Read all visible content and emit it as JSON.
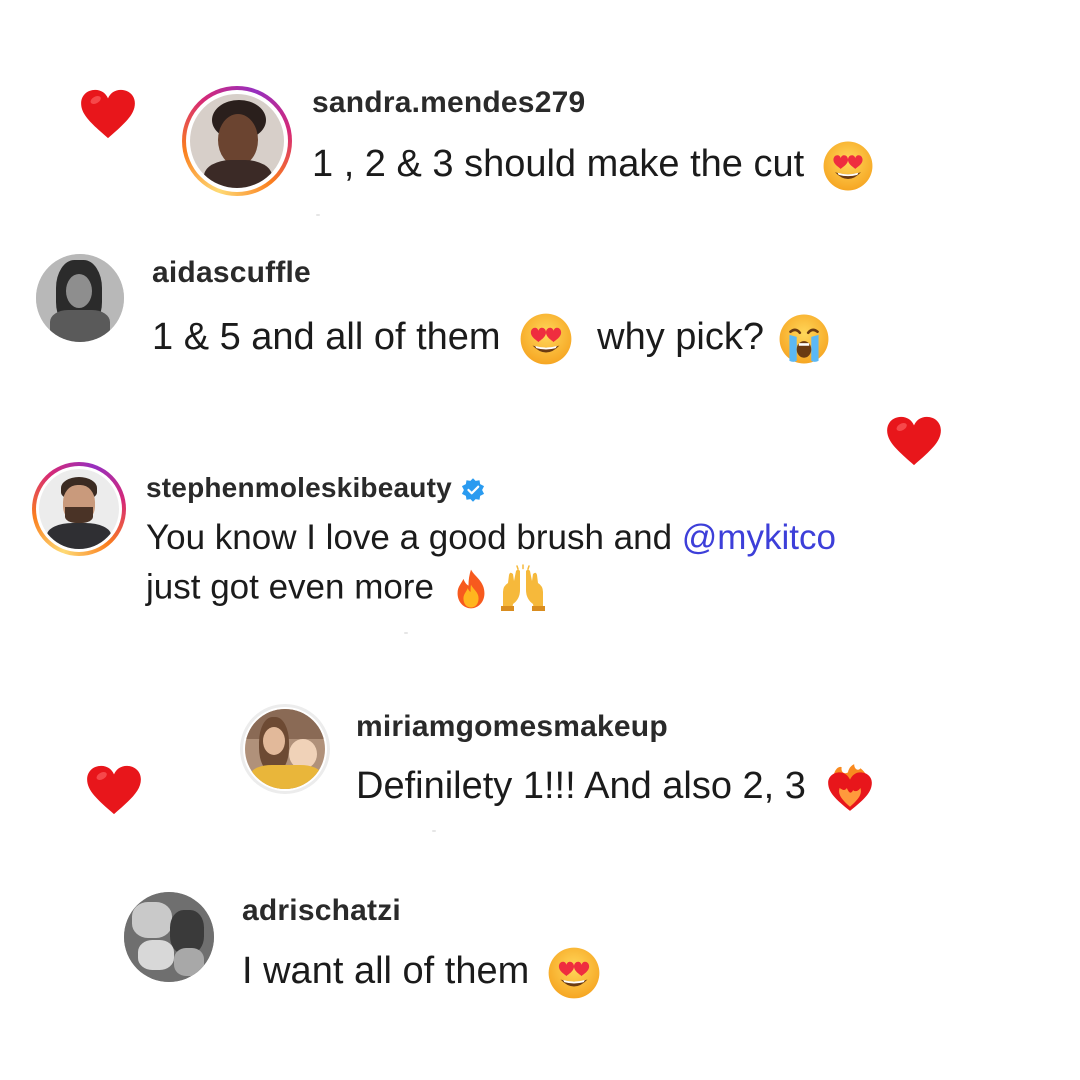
{
  "colors": {
    "heart": "#e8161b",
    "mention": "#3d3fd9",
    "verified": "#2a9bf0",
    "text": "#1b1b1b"
  },
  "comments": [
    {
      "username": "sandra.mendes279",
      "text": "1 , 2 & 3 should make the cut",
      "emojis": [
        "heart-eyes-emoji"
      ],
      "liked": true,
      "story_ring": true
    },
    {
      "username": "aidascuffle",
      "text_a": "1 &  5 and all of them",
      "text_b": "why pick?",
      "emojis": [
        "heart-eyes-emoji",
        "crying-emoji"
      ],
      "liked": false,
      "story_ring": false
    },
    {
      "username": "stephenmoleskibeauty",
      "verified": true,
      "text_line1": "You know I love a good brush and ",
      "mention": "@mykitco",
      "text_line2": "just got even more",
      "emojis": [
        "fire-emoji",
        "raising-hands-emoji"
      ],
      "liked": true,
      "story_ring": true
    },
    {
      "username": "miriamgomesmakeup",
      "text": "Definilety 1!!! And also 2, 3",
      "emojis": [
        "heart-on-fire-emoji"
      ],
      "liked": true,
      "story_ring": false
    },
    {
      "username": "adrischatzi",
      "text": "I want all of them",
      "emojis": [
        "heart-eyes-emoji"
      ],
      "liked": false,
      "story_ring": false
    }
  ]
}
